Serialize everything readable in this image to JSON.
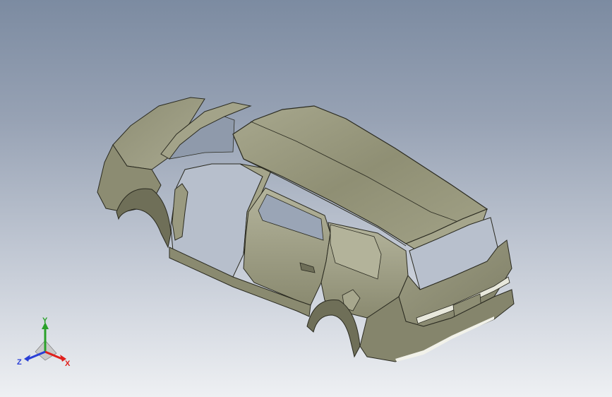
{
  "viewport": {
    "background_top": "#7c8ba1",
    "background_bottom": "#eef0f3",
    "model_color": "#9a9a80"
  },
  "triad": {
    "x_label": "X",
    "y_label": "Y",
    "z_label": "Z",
    "x_color": "#e0201c",
    "y_color": "#2aa12a",
    "z_color": "#2a3fd6"
  }
}
